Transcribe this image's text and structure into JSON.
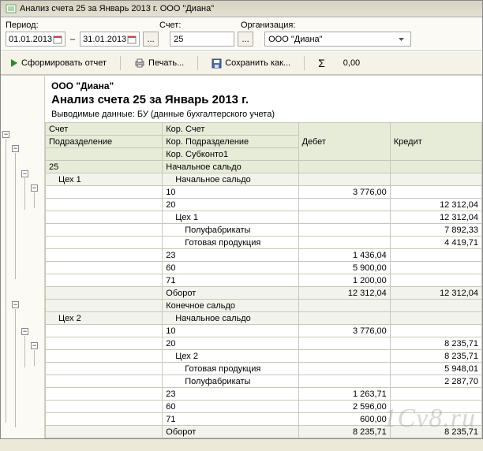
{
  "window": {
    "title": "Анализ счета 25 за Январь 2013 г. ООО \"Диана\""
  },
  "filters": {
    "period_label": "Период:",
    "date_from": "01.01.2013",
    "date_to": "31.01.2013",
    "schet_label": "Счет:",
    "schet_value": "25",
    "org_label": "Организация:",
    "org_value": "ООО \"Диана\""
  },
  "toolbar": {
    "generate": "Сформировать отчет",
    "print": "Печать...",
    "save_as": "Сохранить как...",
    "sigma": "Σ",
    "sum_value": "0,00"
  },
  "report": {
    "org": "ООО \"Диана\"",
    "title": "Анализ счета 25 за Январь 2013 г.",
    "subtitle": "Выводимые данные: БУ (данные бухгалтерского учета)",
    "headers": {
      "schet": "Счет",
      "podrazdelenie": "Подразделение",
      "kor_schet": "Кор. Счет",
      "kor_podrazdelenie": "Кор. Подразделение",
      "kor_subkonto1": "Кор. Субконто1",
      "debet": "Дебет",
      "kredit": "Кредит"
    },
    "labels": {
      "nach_saldo": "Начальное сальдо",
      "kon_saldo": "Конечное сальдо",
      "oborot": "Оборот",
      "polufabrikaty": "Полуфабрикаты",
      "gotov_prod": "Готовая продукция"
    },
    "rows": [
      {
        "s": "25",
        "k": "Начальное сальдо",
        "d": "",
        "c": "",
        "bg": "green",
        "si": 0,
        "ki": 0
      },
      {
        "s": "Цех 1",
        "k": "Начальное сальдо",
        "d": "",
        "c": "",
        "bg": "gray",
        "si": 1,
        "ki": 1
      },
      {
        "s": "",
        "k": "10",
        "d": "3 776,00",
        "c": "",
        "bg": "white",
        "si": 0,
        "ki": 0
      },
      {
        "s": "",
        "k": "20",
        "d": "",
        "c": "12 312,04",
        "bg": "white",
        "si": 0,
        "ki": 0
      },
      {
        "s": "",
        "k": "Цех 1",
        "d": "",
        "c": "12 312,04",
        "bg": "white",
        "si": 0,
        "ki": 1
      },
      {
        "s": "",
        "k": "Полуфабрикаты",
        "d": "",
        "c": "7 892,33",
        "bg": "white",
        "si": 0,
        "ki": 2
      },
      {
        "s": "",
        "k": "Готовая продукция",
        "d": "",
        "c": "4 419,71",
        "bg": "white",
        "si": 0,
        "ki": 2
      },
      {
        "s": "",
        "k": "23",
        "d": "1 436,04",
        "c": "",
        "bg": "white",
        "si": 0,
        "ki": 0
      },
      {
        "s": "",
        "k": "60",
        "d": "5 900,00",
        "c": "",
        "bg": "white",
        "si": 0,
        "ki": 0
      },
      {
        "s": "",
        "k": "71",
        "d": "1 200,00",
        "c": "",
        "bg": "white",
        "si": 0,
        "ki": 0
      },
      {
        "s": "",
        "k": "Оборот",
        "d": "12 312,04",
        "c": "12 312,04",
        "bg": "gray",
        "si": 0,
        "ki": 0
      },
      {
        "s": "",
        "k": "Конечное сальдо",
        "d": "",
        "c": "",
        "bg": "gray",
        "si": 0,
        "ki": 0
      },
      {
        "s": "Цех 2",
        "k": "Начальное сальдо",
        "d": "",
        "c": "",
        "bg": "gray",
        "si": 1,
        "ki": 1
      },
      {
        "s": "",
        "k": "10",
        "d": "3 776,00",
        "c": "",
        "bg": "white",
        "si": 0,
        "ki": 0
      },
      {
        "s": "",
        "k": "20",
        "d": "",
        "c": "8 235,71",
        "bg": "white",
        "si": 0,
        "ki": 0
      },
      {
        "s": "",
        "k": "Цех 2",
        "d": "",
        "c": "8 235,71",
        "bg": "white",
        "si": 0,
        "ki": 1
      },
      {
        "s": "",
        "k": "Готовая продукция",
        "d": "",
        "c": "5 948,01",
        "bg": "white",
        "si": 0,
        "ki": 2
      },
      {
        "s": "",
        "k": "Полуфабрикаты",
        "d": "",
        "c": "2 287,70",
        "bg": "white",
        "si": 0,
        "ki": 2
      },
      {
        "s": "",
        "k": "23",
        "d": "1 263,71",
        "c": "",
        "bg": "white",
        "si": 0,
        "ki": 0
      },
      {
        "s": "",
        "k": "60",
        "d": "2 596,00",
        "c": "",
        "bg": "white",
        "si": 0,
        "ki": 0
      },
      {
        "s": "",
        "k": "71",
        "d": "600,00",
        "c": "",
        "bg": "white",
        "si": 0,
        "ki": 0
      },
      {
        "s": "",
        "k": "Оборот",
        "d": "8 235,71",
        "c": "8 235,71",
        "bg": "gray",
        "si": 0,
        "ki": 0
      }
    ]
  },
  "watermark": "1Cv8.ru"
}
